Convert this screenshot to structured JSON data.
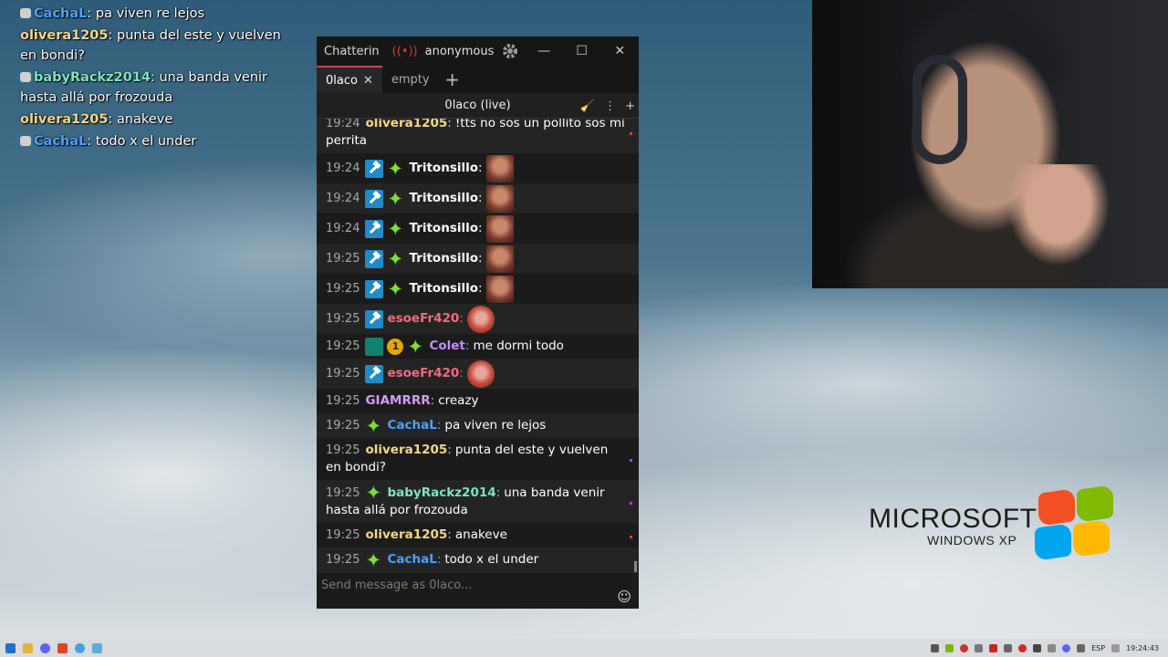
{
  "overlay_chat": [
    {
      "badge": true,
      "user": "CachaL",
      "color": "#4aa3ff",
      "text": "pa viven re lejos"
    },
    {
      "badge": false,
      "user": "olivera1205",
      "color": "#f3d68a",
      "text": "punta del este y vuelven en bondi?"
    },
    {
      "badge": true,
      "user": "babyRackz2014",
      "color": "#7de3c1",
      "text": "una banda venir hasta allá por frozouda"
    },
    {
      "badge": false,
      "user": "olivera1205",
      "color": "#f3d68a",
      "text": "anakeve"
    },
    {
      "badge": true,
      "user": "CachaL",
      "color": "#4aa3ff",
      "text": "todo x el under"
    }
  ],
  "window": {
    "app_name": "Chatterin",
    "account": "anonymous",
    "tabs": [
      {
        "label": "0laco",
        "active": true
      },
      {
        "label": "empty",
        "active": false
      }
    ],
    "channel_title": "0laco (live)",
    "input_placeholder": "Send message as 0laco..."
  },
  "messages": [
    {
      "time": "19:24",
      "user": "olivera1205",
      "color": "#f3d68a",
      "text": "!tts no sos un pollito sos mi perrita",
      "wrap": true,
      "alt": true,
      "mark": "#d84040"
    },
    {
      "time": "19:24",
      "badges": [
        "mod",
        "spark"
      ],
      "user": "Tritonsillo",
      "color": "#ffffff",
      "text": "",
      "emote": "square"
    },
    {
      "time": "19:24",
      "badges": [
        "mod",
        "spark"
      ],
      "user": "Tritonsillo",
      "color": "#ffffff",
      "text": "",
      "emote": "square",
      "alt": true
    },
    {
      "time": "19:24",
      "badges": [
        "mod",
        "spark"
      ],
      "user": "Tritonsillo",
      "color": "#ffffff",
      "text": "",
      "emote": "square"
    },
    {
      "time": "19:25",
      "badges": [
        "mod",
        "spark"
      ],
      "user": "Tritonsillo",
      "color": "#ffffff",
      "text": "",
      "emote": "square",
      "alt": true
    },
    {
      "time": "19:25",
      "badges": [
        "mod",
        "spark"
      ],
      "user": "Tritonsillo",
      "color": "#ffffff",
      "text": "",
      "emote": "square"
    },
    {
      "time": "19:25",
      "badges": [
        "mod"
      ],
      "user": "esoeFr420",
      "color": "#f06b7e",
      "text": "",
      "emote": "round",
      "alt": true
    },
    {
      "time": "19:25",
      "badges": [
        "vip",
        "sub1",
        "spark"
      ],
      "user": "Colet",
      "color": "#c78cff",
      "text": "me dormi todo"
    },
    {
      "time": "19:25",
      "badges": [
        "mod"
      ],
      "user": "esoeFr420",
      "color": "#f06b7e",
      "text": "",
      "emote": "round",
      "alt": true
    },
    {
      "time": "19:25",
      "badges": [],
      "user": "GIAMRRR",
      "color": "#d39cf3",
      "text": "creazy"
    },
    {
      "time": "19:25",
      "badges": [
        "spark"
      ],
      "user": "CachaL",
      "color": "#4aa3ff",
      "text": "pa viven re lejos",
      "alt": true
    },
    {
      "time": "19:25",
      "badges": [],
      "user": "olivera1205",
      "color": "#f3d68a",
      "text": "punta del este y vuelven en bondi?",
      "wrap": true,
      "mark": "#a040f0"
    },
    {
      "time": "19:25",
      "badges": [
        "spark"
      ],
      "user": "babyRackz2014",
      "color": "#7de3c1",
      "text": "una banda venir hasta allá por frozouda",
      "wrap": true,
      "alt": true,
      "mark": "#a040f0"
    },
    {
      "time": "19:25",
      "badges": [],
      "user": "olivera1205",
      "color": "#f3d68a",
      "text": "anakeve",
      "mark": "#d84040"
    },
    {
      "time": "19:25",
      "badges": [
        "spark"
      ],
      "user": "CachaL",
      "color": "#4aa3ff",
      "text": "todo x el under",
      "alt": true
    }
  ],
  "desktop_logo": {
    "line1": "MICROSOFT",
    "line2": "WINDOWS XP"
  },
  "taskbar": {
    "lang": "ESP",
    "clock": "19:24:43"
  }
}
